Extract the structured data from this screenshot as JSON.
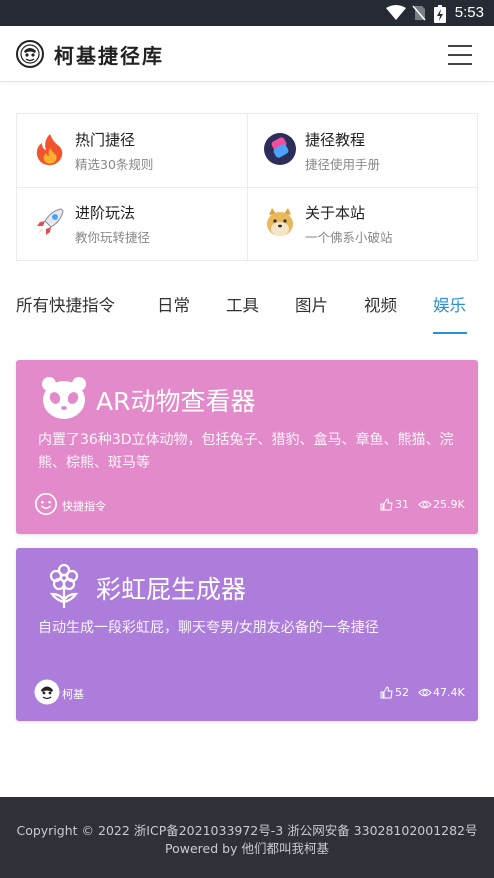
{
  "status_bar": {
    "time": "5:53"
  },
  "header": {
    "title": "柯基捷径库"
  },
  "quick_links": [
    {
      "title": "热门捷径",
      "subtitle": "精选30条规则",
      "icon": "fire-icon"
    },
    {
      "title": "捷径教程",
      "subtitle": "捷径使用手册",
      "icon": "shortcuts-icon"
    },
    {
      "title": "进阶玩法",
      "subtitle": "教你玩转捷径",
      "icon": "rocket-icon"
    },
    {
      "title": "关于本站",
      "subtitle": "一个佛系小破站",
      "icon": "doge-icon"
    }
  ],
  "tabs": [
    {
      "label": "所有快捷指令",
      "active": false
    },
    {
      "label": "日常",
      "active": false
    },
    {
      "label": "工具",
      "active": false
    },
    {
      "label": "图片",
      "active": false
    },
    {
      "label": "视频",
      "active": false
    },
    {
      "label": "娱乐",
      "active": true
    }
  ],
  "cards": [
    {
      "title": "AR动物查看器",
      "description": "内置了36种3D立体动物，包括兔子、猎豹、盒马、章鱼、熊猫、浣熊、棕熊、斑马等",
      "author": "快捷指令",
      "likes": "31",
      "views": "25.9K",
      "color": "#e38aca",
      "icon": "panda-icon"
    },
    {
      "title": "彩虹屁生成器",
      "description": "自动生成一段彩虹屁，聊天夸男/女朋友必备的一条捷径",
      "author": "柯基",
      "likes": "52",
      "views": "47.4K",
      "color": "#ad7ddc",
      "icon": "flower-icon"
    }
  ],
  "footer": {
    "line1": "Copyright © 2022 浙ICP备2021033972号-3 浙公网安备 33028102001282号",
    "line2": "Powered by 他们都叫我柯基"
  },
  "colors": {
    "accent": "#2a8fd6",
    "footer_bg": "#2e3238",
    "status_bar": "#262a33"
  }
}
